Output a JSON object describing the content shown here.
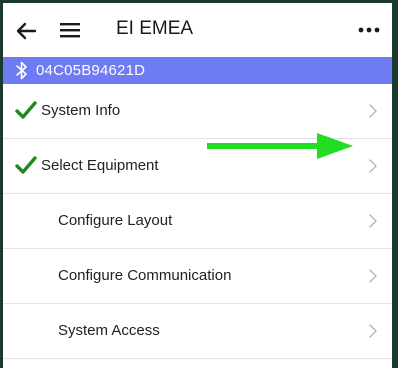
{
  "app": {
    "title": "EI EMEA"
  },
  "device": {
    "id": "04C05B94621D"
  },
  "list": {
    "items": [
      {
        "label": "System Info",
        "completed": true
      },
      {
        "label": "Select Equipment",
        "completed": true
      },
      {
        "label": "Configure Layout",
        "completed": false
      },
      {
        "label": "Configure Communication",
        "completed": false
      },
      {
        "label": "System Access",
        "completed": false
      }
    ]
  },
  "colors": {
    "device_bar": "#6e7bf2",
    "check": "#1f8a1f",
    "annotation_arrow": "#22dd22",
    "frame": "#1b3a2c"
  },
  "icons": {
    "back": "back-arrow-icon",
    "menu": "hamburger-menu-icon",
    "more": "more-dots-icon",
    "bluetooth": "bluetooth-icon",
    "check": "checkmark-icon",
    "chevron": "chevron-right-icon"
  }
}
